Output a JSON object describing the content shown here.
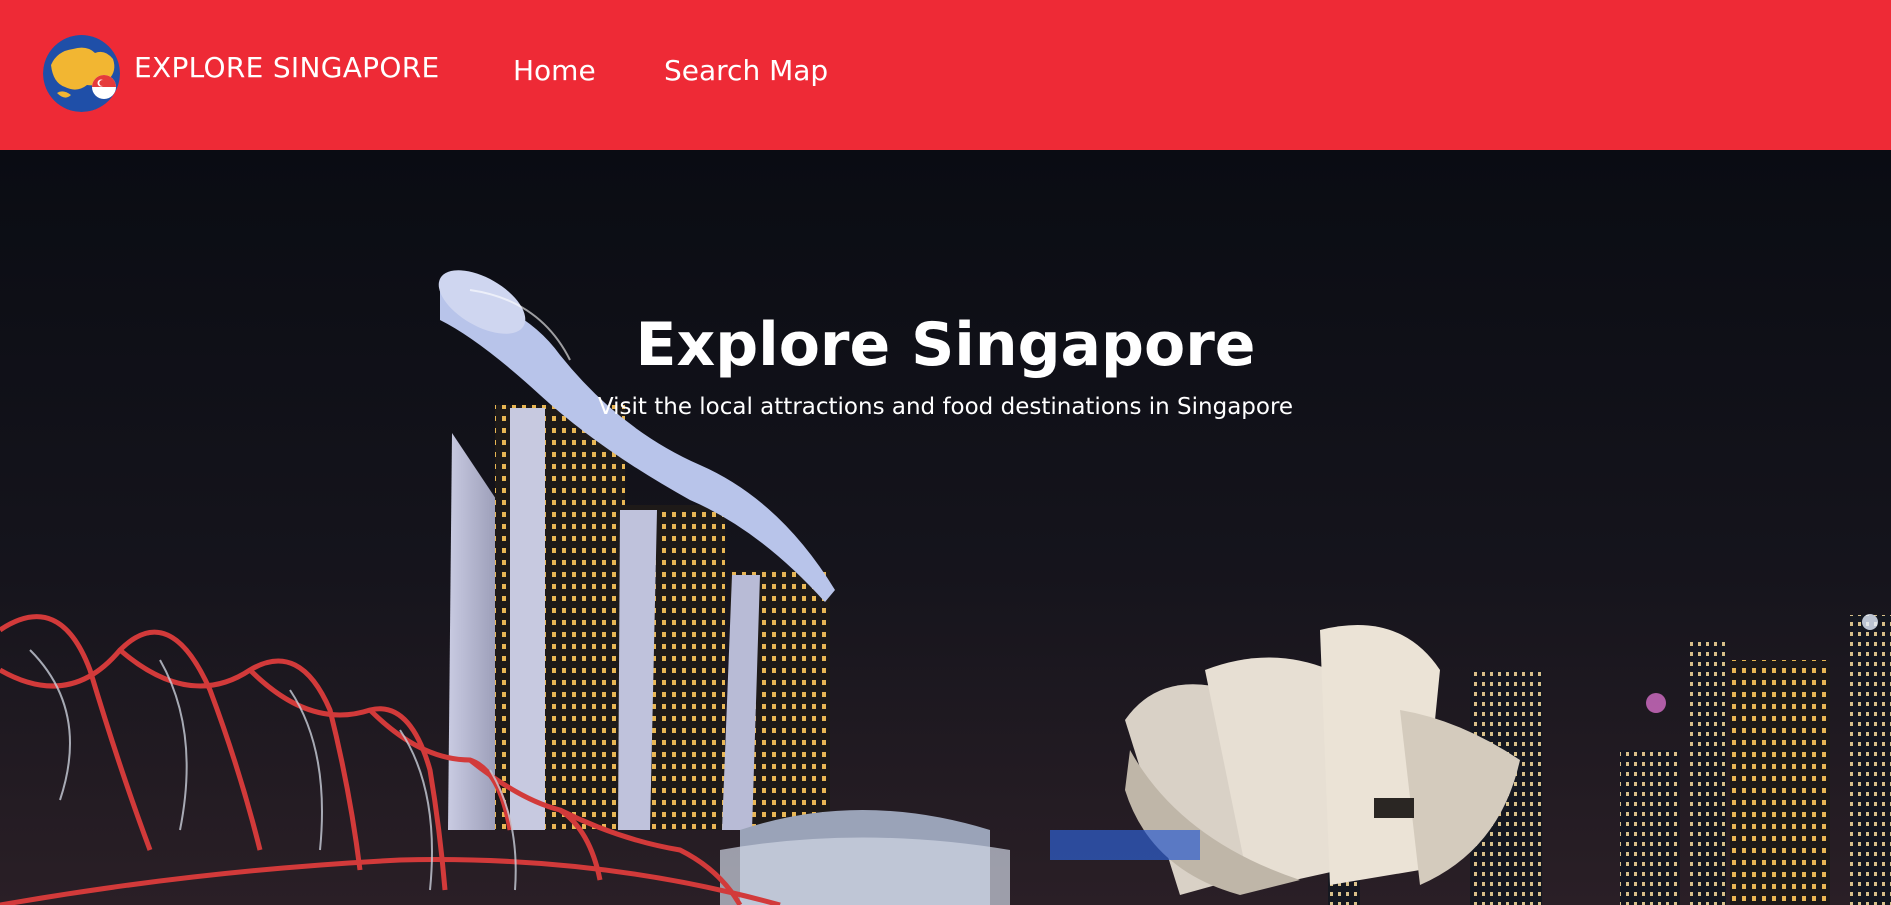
{
  "navbar": {
    "brand": "EXPLORE SINGAPORE",
    "links": [
      {
        "label": "Home"
      },
      {
        "label": "Search Map"
      }
    ],
    "colors": {
      "background": "#ee2a36",
      "text": "#ffffff"
    }
  },
  "hero": {
    "title": "Explore Singapore",
    "subtitle": "Visit the local attractions and food destinations in Singapore",
    "background_icon": "singapore-skyline-night-photo"
  },
  "icons": {
    "logo": "singapore-globe-flag-icon"
  }
}
